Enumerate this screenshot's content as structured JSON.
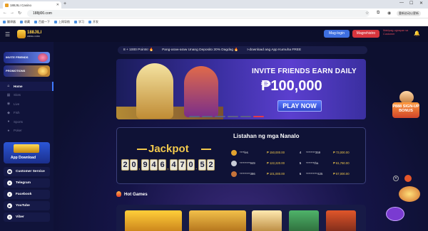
{
  "browser": {
    "tab_title": "188JILI Casino",
    "url": "188jl00.com",
    "profile_label": "重新启动以更新",
    "bookmarks": [
      "翻译器",
      "收藏",
      "百度一下",
      "上网导航",
      "学习",
      "开发"
    ]
  },
  "header": {
    "logo_text": "188JILI",
    "logo_sub": "188JILI.COM",
    "login_label": "Mag-login",
    "register_label": "Magrehistro",
    "support_label": "Makipag-ugnayan sa Customer"
  },
  "sidebar": {
    "invite_label": "INVITE FRIENDS",
    "promotions_label": "PROMOTIONS",
    "menu": [
      {
        "label": "Home",
        "icon": "home-icon"
      },
      {
        "label": "Slots",
        "icon": "slots-icon"
      },
      {
        "label": "Live",
        "icon": "live-icon"
      },
      {
        "label": "Fish",
        "icon": "fish-icon"
      },
      {
        "label": "Sports",
        "icon": "sports-icon"
      },
      {
        "label": "Poker",
        "icon": "poker-icon"
      }
    ],
    "app_download_label": "App Download",
    "social": [
      {
        "label": "Customer Service",
        "icon": "headset-icon"
      },
      {
        "label": "Telegram",
        "icon": "telegram-icon"
      },
      {
        "label": "Facebook",
        "icon": "facebook-icon"
      },
      {
        "label": "YouTube",
        "icon": "youtube-icon"
      },
      {
        "label": "Viber",
        "icon": "viber-icon"
      }
    ]
  },
  "ticker": [
    "8 + 1000 Points! 🔥",
    "Pang-araw-araw Unang Deposito 20% Dagdag 🔥",
    "I-download ang App Kumuha FREE"
  ],
  "banner": {
    "title": "INVITE FRIENDS EARN DAILY",
    "amount": "₱100,000",
    "play_label": "PLAY NOW"
  },
  "jackpot": {
    "title": "Jackpot",
    "digits": [
      "2",
      "0",
      ",",
      "9",
      "4",
      "6",
      ",",
      "4",
      "7",
      "0",
      ".",
      "5",
      "2"
    ]
  },
  "winners": {
    "title": "Listahan ng mga Nanalo",
    "rows": [
      {
        "left_name": "****les",
        "left_amount": "₱ 150,000.00",
        "right_rank": "4",
        "right_name": "********359",
        "right_amount": "₱ 73,000.00"
      },
      {
        "left_name": "*********949",
        "left_amount": "₱ 122,220.00",
        "right_rank": "5",
        "right_name": "*******tha",
        "right_amount": "₱ 61,760.00"
      },
      {
        "left_name": "*********386",
        "left_amount": "₱ 101,000.00",
        "right_rank": "6",
        "right_name": "**********425",
        "right_amount": "₱ 57,000.00"
      }
    ]
  },
  "hot_games_label": "Hot Games",
  "side_promo": {
    "label": "P888 SIGN-UP BONUS"
  },
  "colors": {
    "login": "#3e6fe0",
    "register": "#d8353d",
    "jackpot_gold": "#f2c94c",
    "active_dot": "#e03a4a"
  }
}
